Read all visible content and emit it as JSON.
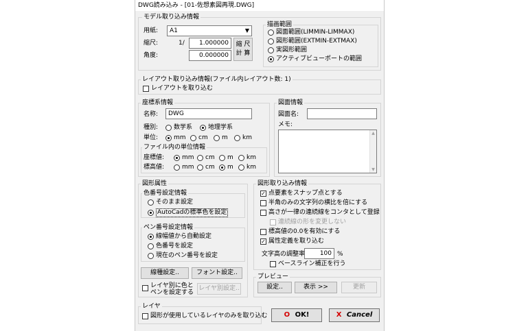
{
  "title": "DWG読み込み - [01-佐想素図再現.DWG]",
  "model": {
    "group_label": "モデル取り込み情報",
    "paper_label": "用紙:",
    "paper_value": "A1",
    "scale_label": "縮尺:",
    "scale_prefix": "1/",
    "scale_value": "1.000000",
    "angle_label": "角度:",
    "angle_value": "0.000000",
    "calc_button_line1": "縮 尺",
    "calc_button_line2": "計 算",
    "draw_range": {
      "label": "描画範囲",
      "options": [
        "図面範囲(LIMMIN-LIMMAX)",
        "図形範囲(EXTMIN-EXTMAX)",
        "実図形範囲",
        "アクティブビューポートの範囲"
      ],
      "selected_index": 3
    }
  },
  "layout": {
    "group_label": "レイアウト取り込み情報(ファイル内レイアウト数: 1)",
    "import_label": "レイアウトを取り込む"
  },
  "coord": {
    "group_label": "座標系情報",
    "name_label": "名称:",
    "name_value": "DWG",
    "type_label": "種別:",
    "type_options": [
      "数学系",
      "地理学系"
    ],
    "type_selected": 1,
    "unit_label": "単位:",
    "units": [
      "mm",
      "cm",
      "m",
      "km"
    ],
    "unit_selected": 0,
    "file_unit_label": "ファイル内の単位情報",
    "coord_value_label": "座標値:",
    "coord_unit_selected": 0,
    "elev_value_label": "標高値:",
    "elev_unit_selected": 2
  },
  "drawing": {
    "group_label": "図面情報",
    "name_label": "図面名:",
    "memo_label": "メモ:"
  },
  "attributes": {
    "group_label": "図形属性",
    "color_group_label": "色番号設定情報",
    "color_options": [
      "そのまま設定",
      "AutoCadの標準色を設定"
    ],
    "color_selected": 1,
    "pen_group_label": "ペン番号設定情報",
    "pen_options": [
      "線幅値から自動設定",
      "色番号を設定",
      "現在のペン番号を設定"
    ],
    "pen_selected": 0,
    "linewidth_button": "線種設定..",
    "font_button": "フォント設定..",
    "per_layer_line1": "レイヤ別に色と",
    "per_layer_line2": "ペンを設定する",
    "per_layer_button": "レイヤ別設定.."
  },
  "import": {
    "group_label": "図形取り込み情報",
    "options": [
      {
        "label": "点要素をスナップ点とする",
        "checked": true
      },
      {
        "label": "半角のみの文字列の横比を倍にする",
        "checked": false
      },
      {
        "label": "高さが一律の連続線をコンタとして登録",
        "checked": false
      },
      {
        "label": "連続線の形を変更しない",
        "checked": false,
        "disabled": true
      },
      {
        "label": "標高値の0.0を有効にする",
        "checked": false
      },
      {
        "label": "属性定義を取り込む",
        "checked": true
      }
    ],
    "text_ratio_label": "文字高の調整率:",
    "text_ratio_value": "100",
    "text_ratio_unit": "%",
    "baseline_label": "ベースライン補正を行う"
  },
  "preview": {
    "group_label": "プレビュー",
    "settings_button": "設定..",
    "show_button": "表示 >>",
    "update_button": "更新"
  },
  "layer": {
    "group_label": "レイヤ",
    "only_used_label": "図形が使用しているレイヤのみを取り込む"
  },
  "actions": {
    "ok_mark": "O",
    "ok_label": "OK!",
    "cancel_mark": "X",
    "cancel_label": "Cancel"
  }
}
